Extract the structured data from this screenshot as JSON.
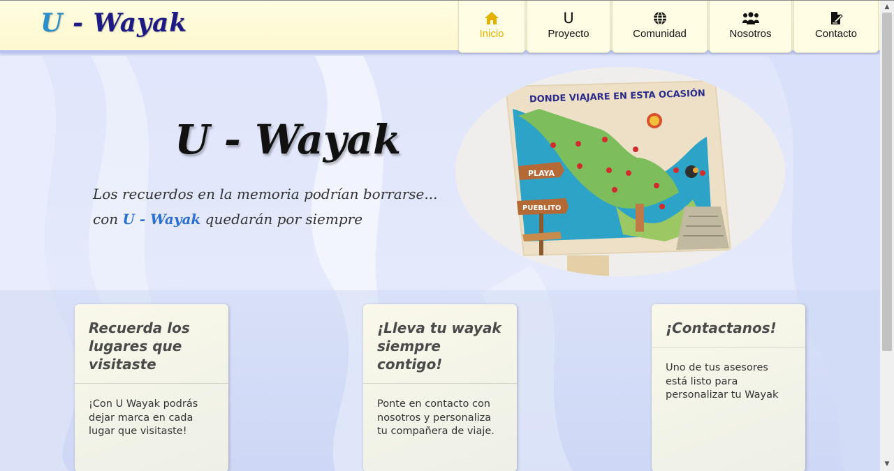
{
  "header": {
    "logo": {
      "initial": "U",
      "rest": " - Wayak"
    },
    "nav": [
      {
        "label": "Inicio",
        "icon": "home-icon",
        "glyph": "⌂",
        "active": true
      },
      {
        "label": "Proyecto",
        "icon": "u-logo-icon",
        "glyph": "U",
        "active": false
      },
      {
        "label": "Comunidad",
        "icon": "globe-icon",
        "glyph": "",
        "active": false
      },
      {
        "label": "Nosotros",
        "icon": "users-icon",
        "glyph": "",
        "active": false
      },
      {
        "label": "Contacto",
        "icon": "edit-document-icon",
        "glyph": "",
        "active": false
      }
    ]
  },
  "hero": {
    "title": "U - Wayak",
    "tagline_line1": "Los recuerdos en la memoria podrían borrarse...",
    "tagline_prefix": "con ",
    "tagline_brand": "U - Wayak",
    "tagline_suffix": " quedarán por siempre",
    "image": {
      "title": "DONDE VIAJARE EN ESTA OCASIÓN",
      "sign1": "PLAYA",
      "sign2": "PUEBLITO"
    }
  },
  "cards": [
    {
      "title": "Recuerda los lugares que visitaste",
      "body": "¡Con U Wayak podrás dejar marca en cada lugar que visitaste!"
    },
    {
      "title": "¡Lleva tu wayak siempre contigo!",
      "body": "Ponte en contacto con nosotros y personaliza tu compañera de viaje."
    },
    {
      "title": "¡Contactanos!",
      "body": "Uno de tus asesores está listo para personalizar tu Wayak"
    }
  ],
  "colors": {
    "active_nav": "#e2b200",
    "logo": "#1d1a86",
    "brand_blue": "#2b6fd0"
  }
}
